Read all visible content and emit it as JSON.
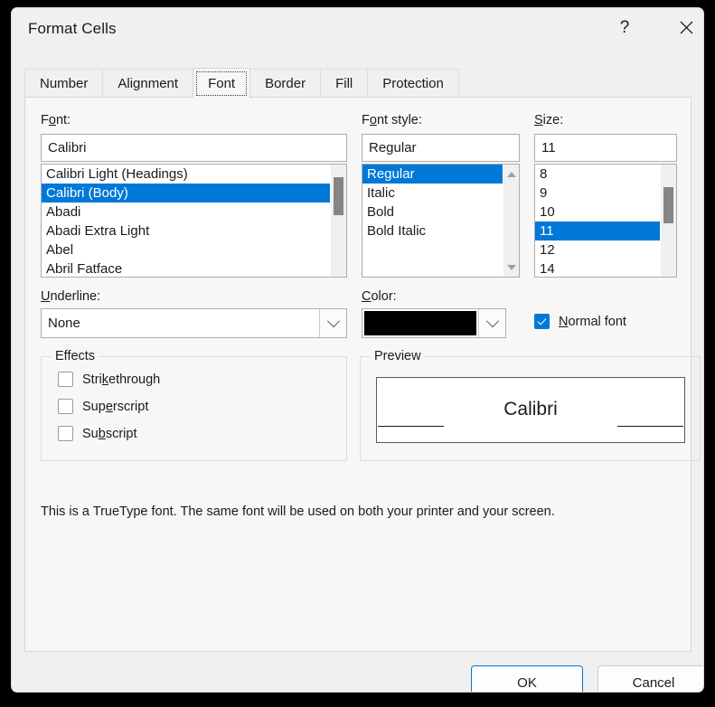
{
  "window": {
    "title": "Format Cells",
    "help_icon": "question-mark-icon",
    "close_icon": "close-x-icon"
  },
  "tabs": [
    {
      "label": "Number",
      "selected": false
    },
    {
      "label": "Alignment",
      "selected": false
    },
    {
      "label": "Font",
      "selected": true
    },
    {
      "label": "Border",
      "selected": false
    },
    {
      "label": "Fill",
      "selected": false
    },
    {
      "label": "Protection",
      "selected": false
    }
  ],
  "font": {
    "label_pre": "F",
    "label_acc": "o",
    "label_post": "nt:",
    "value": "Calibri",
    "items": [
      "Calibri Light (Headings)",
      "Calibri (Body)",
      "Abadi",
      "Abadi Extra Light",
      "Abel",
      "Abril Fatface"
    ],
    "selected_index": 1
  },
  "font_style": {
    "label_pre": "F",
    "label_acc": "o",
    "label_post": "nt style:",
    "value": "Regular",
    "items": [
      "Regular",
      "Italic",
      "Bold",
      "Bold Italic"
    ],
    "selected_index": 0,
    "scroll_up_icon": "triangle-up-icon",
    "scroll_down_icon": "triangle-down-icon"
  },
  "size": {
    "label_acc": "S",
    "label_post": "ize:",
    "value": "11",
    "items": [
      "8",
      "9",
      "10",
      "11",
      "12",
      "14"
    ],
    "selected_index": 3
  },
  "underline": {
    "label_acc": "U",
    "label_post": "nderline:",
    "value": "None",
    "chevron_icon": "chevron-down-icon"
  },
  "color": {
    "label_acc": "C",
    "label_post": "olor:",
    "value": "#000000",
    "chevron_icon": "chevron-down-icon"
  },
  "normal_font": {
    "checked": true,
    "label_pre": "",
    "label_acc": "N",
    "label_post": "ormal font"
  },
  "effects": {
    "title": "Effects",
    "items": [
      {
        "pre": "Stri",
        "acc": "k",
        "post": "ethrough",
        "checked": false
      },
      {
        "pre": "Sup",
        "acc": "e",
        "post": "rscript",
        "checked": false
      },
      {
        "pre": "Su",
        "acc": "b",
        "post": "script",
        "checked": false
      }
    ]
  },
  "preview": {
    "title": "Preview",
    "sample_text": "Calibri"
  },
  "status": {
    "text": "This is a TrueType font.  The same font will be used on both your printer and your screen."
  },
  "footer": {
    "ok_label": "OK",
    "cancel_label": "Cancel"
  },
  "colors": {
    "accent": "#0078d7",
    "selection": "#0078d7",
    "dialog_bg": "#f0f0f0",
    "page_bg": "#f7f7f7"
  }
}
